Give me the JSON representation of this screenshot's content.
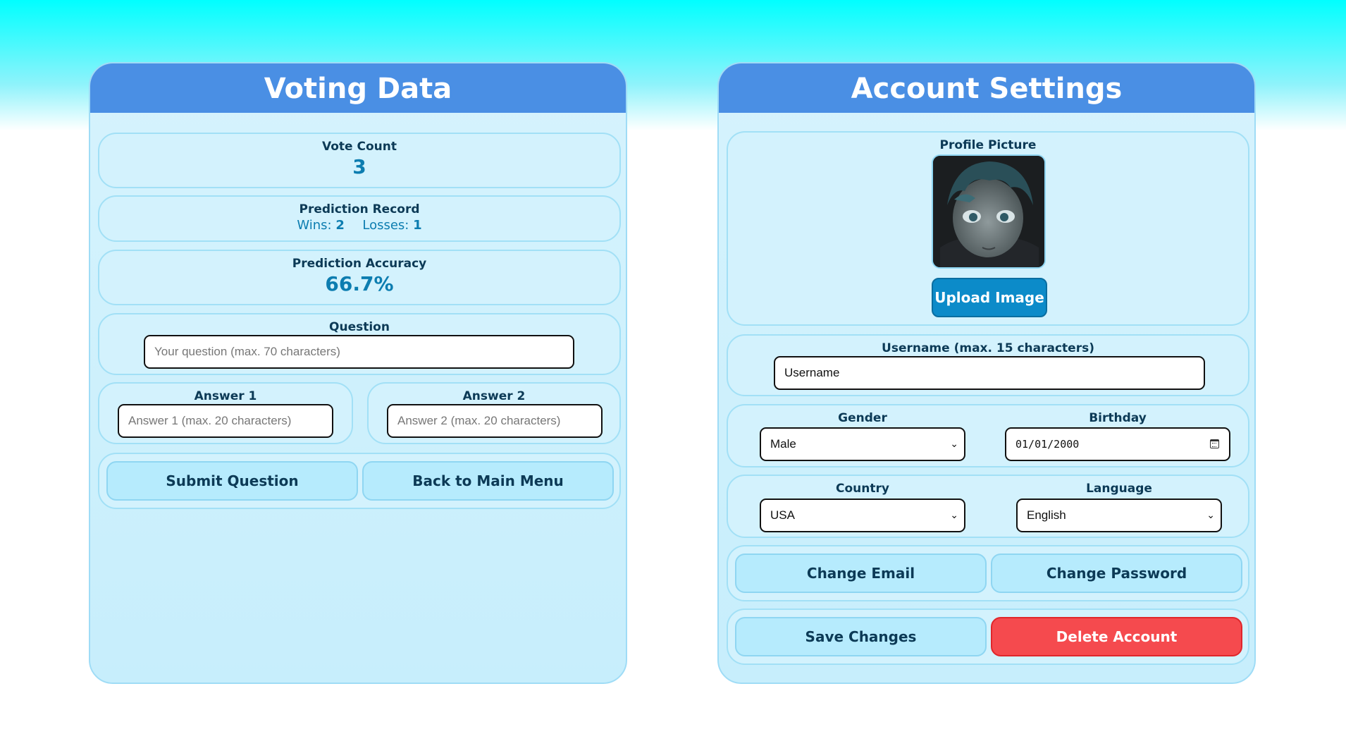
{
  "voting": {
    "title": "Voting Data",
    "vote_count_label": "Vote Count",
    "vote_count_value": "3",
    "prediction_record_label": "Prediction Record",
    "wins_label": "Wins:",
    "wins_value": "2",
    "losses_label": "Losses:",
    "losses_value": "1",
    "accuracy_label": "Prediction Accuracy",
    "accuracy_value": "66.7%",
    "question_label": "Question",
    "question_placeholder": "Your question (max. 70 characters)",
    "answer1_label": "Answer 1",
    "answer1_placeholder": "Answer 1 (max. 20 characters)",
    "answer2_label": "Answer 2",
    "answer2_placeholder": "Answer 2 (max. 20 characters)",
    "submit_label": "Submit Question",
    "back_label": "Back to Main Menu"
  },
  "account": {
    "title": "Account Settings",
    "profile_picture_label": "Profile Picture",
    "upload_label": "Upload Image",
    "username_label": "Username (max. 15 characters)",
    "username_value": "Username",
    "gender_label": "Gender",
    "gender_value": "Male",
    "birthday_label": "Birthday",
    "birthday_value": "01/01/2000",
    "country_label": "Country",
    "country_value": "USA",
    "language_label": "Language",
    "language_value": "English",
    "change_email_label": "Change Email",
    "change_password_label": "Change Password",
    "save_label": "Save Changes",
    "delete_label": "Delete Account"
  },
  "colors": {
    "header": "#4a8fe4",
    "accent_value": "#0c7db0",
    "danger": "#f54a4e",
    "primary_button": "#0c8bc9"
  },
  "icons": {
    "select_arrow": "chevron-down-icon",
    "calendar": "calendar-icon",
    "avatar": "avatar-image"
  }
}
